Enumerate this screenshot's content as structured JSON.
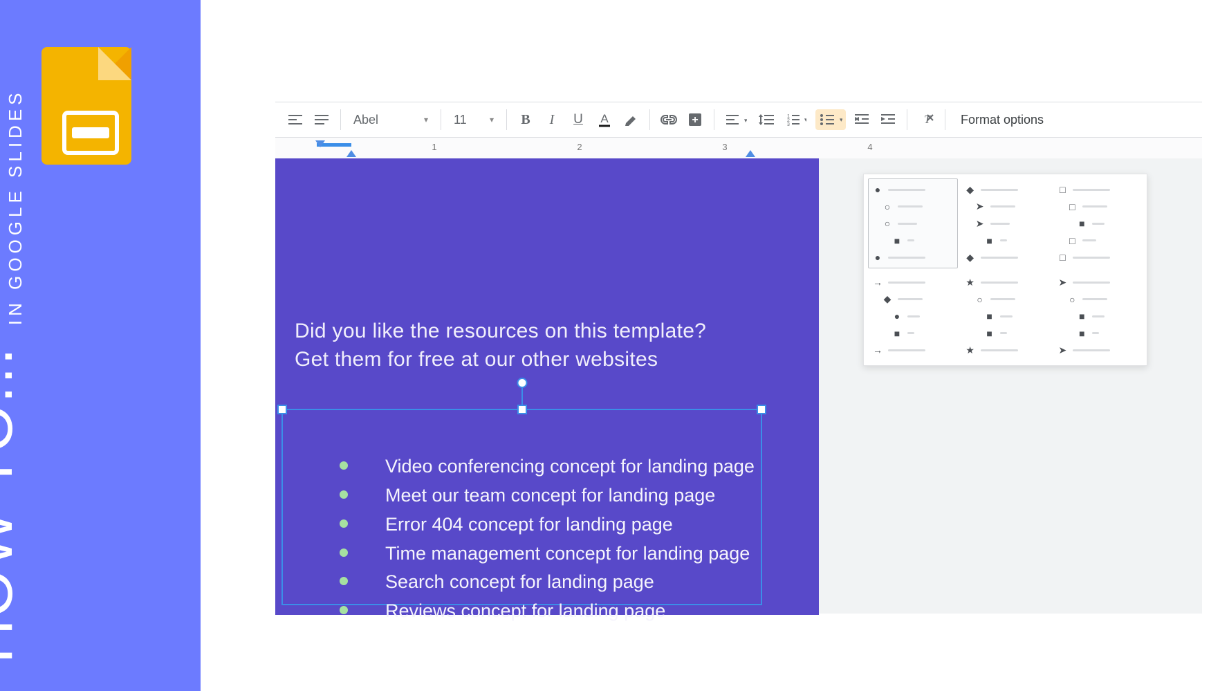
{
  "howto": {
    "big": "HOW TO...",
    "small": "IN GOOGLE SLIDES"
  },
  "toolbar": {
    "font": "Abel",
    "font_size": "11",
    "format_options": "Format options"
  },
  "ruler": {
    "numbers": [
      "1",
      "2",
      "3",
      "4"
    ]
  },
  "slide": {
    "title": "Did you like the resources on this template? Get them for free at our other websites",
    "bullets": [
      "Video conferencing concept for landing page",
      "Meet our team concept for landing page",
      "Error 404 concept for landing page",
      "Time management concept for landing page",
      "Search concept for landing page",
      "Reviews concept for landing page"
    ]
  },
  "bullet_panel": {
    "options": [
      {
        "glyphs": [
          "●",
          "○",
          "○",
          "■",
          "●"
        ],
        "indents": [
          0,
          1,
          1,
          2,
          0
        ]
      },
      {
        "glyphs": [
          "◆",
          "➤",
          "➤",
          "■",
          "◆"
        ],
        "indents": [
          0,
          1,
          1,
          2,
          0
        ]
      },
      {
        "glyphs": [
          "□",
          "□",
          "■",
          "□",
          "□"
        ],
        "indents": [
          0,
          1,
          2,
          1,
          0
        ]
      },
      {
        "glyphs": [
          "→",
          "◆",
          "●",
          "■",
          "→"
        ],
        "indents": [
          0,
          1,
          2,
          2,
          0
        ]
      },
      {
        "glyphs": [
          "★",
          "○",
          "■",
          "■",
          "★"
        ],
        "indents": [
          0,
          1,
          2,
          2,
          0
        ]
      },
      {
        "glyphs": [
          "➤",
          "○",
          "■",
          "■",
          "➤"
        ],
        "indents": [
          0,
          1,
          2,
          2,
          0
        ]
      }
    ],
    "selected": 0
  }
}
